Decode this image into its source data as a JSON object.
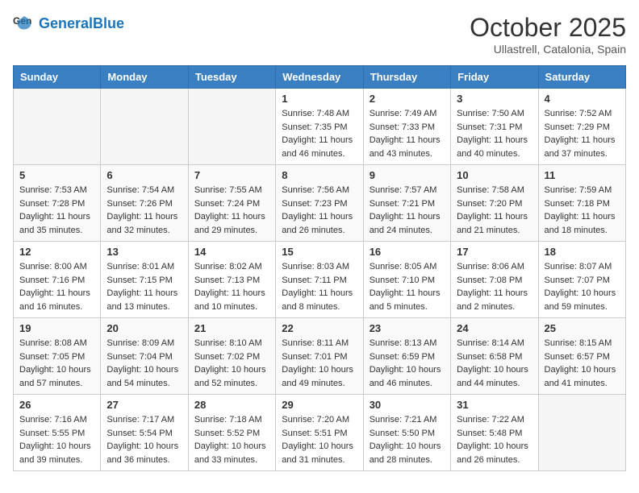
{
  "header": {
    "logo_general": "General",
    "logo_blue": "Blue",
    "month_year": "October 2025",
    "location": "Ullastrell, Catalonia, Spain"
  },
  "days_of_week": [
    "Sunday",
    "Monday",
    "Tuesday",
    "Wednesday",
    "Thursday",
    "Friday",
    "Saturday"
  ],
  "weeks": [
    [
      {
        "day": "",
        "info": ""
      },
      {
        "day": "",
        "info": ""
      },
      {
        "day": "",
        "info": ""
      },
      {
        "day": "1",
        "info": "Sunrise: 7:48 AM\nSunset: 7:35 PM\nDaylight: 11 hours and 46 minutes."
      },
      {
        "day": "2",
        "info": "Sunrise: 7:49 AM\nSunset: 7:33 PM\nDaylight: 11 hours and 43 minutes."
      },
      {
        "day": "3",
        "info": "Sunrise: 7:50 AM\nSunset: 7:31 PM\nDaylight: 11 hours and 40 minutes."
      },
      {
        "day": "4",
        "info": "Sunrise: 7:52 AM\nSunset: 7:29 PM\nDaylight: 11 hours and 37 minutes."
      }
    ],
    [
      {
        "day": "5",
        "info": "Sunrise: 7:53 AM\nSunset: 7:28 PM\nDaylight: 11 hours and 35 minutes."
      },
      {
        "day": "6",
        "info": "Sunrise: 7:54 AM\nSunset: 7:26 PM\nDaylight: 11 hours and 32 minutes."
      },
      {
        "day": "7",
        "info": "Sunrise: 7:55 AM\nSunset: 7:24 PM\nDaylight: 11 hours and 29 minutes."
      },
      {
        "day": "8",
        "info": "Sunrise: 7:56 AM\nSunset: 7:23 PM\nDaylight: 11 hours and 26 minutes."
      },
      {
        "day": "9",
        "info": "Sunrise: 7:57 AM\nSunset: 7:21 PM\nDaylight: 11 hours and 24 minutes."
      },
      {
        "day": "10",
        "info": "Sunrise: 7:58 AM\nSunset: 7:20 PM\nDaylight: 11 hours and 21 minutes."
      },
      {
        "day": "11",
        "info": "Sunrise: 7:59 AM\nSunset: 7:18 PM\nDaylight: 11 hours and 18 minutes."
      }
    ],
    [
      {
        "day": "12",
        "info": "Sunrise: 8:00 AM\nSunset: 7:16 PM\nDaylight: 11 hours and 16 minutes."
      },
      {
        "day": "13",
        "info": "Sunrise: 8:01 AM\nSunset: 7:15 PM\nDaylight: 11 hours and 13 minutes."
      },
      {
        "day": "14",
        "info": "Sunrise: 8:02 AM\nSunset: 7:13 PM\nDaylight: 11 hours and 10 minutes."
      },
      {
        "day": "15",
        "info": "Sunrise: 8:03 AM\nSunset: 7:11 PM\nDaylight: 11 hours and 8 minutes."
      },
      {
        "day": "16",
        "info": "Sunrise: 8:05 AM\nSunset: 7:10 PM\nDaylight: 11 hours and 5 minutes."
      },
      {
        "day": "17",
        "info": "Sunrise: 8:06 AM\nSunset: 7:08 PM\nDaylight: 11 hours and 2 minutes."
      },
      {
        "day": "18",
        "info": "Sunrise: 8:07 AM\nSunset: 7:07 PM\nDaylight: 10 hours and 59 minutes."
      }
    ],
    [
      {
        "day": "19",
        "info": "Sunrise: 8:08 AM\nSunset: 7:05 PM\nDaylight: 10 hours and 57 minutes."
      },
      {
        "day": "20",
        "info": "Sunrise: 8:09 AM\nSunset: 7:04 PM\nDaylight: 10 hours and 54 minutes."
      },
      {
        "day": "21",
        "info": "Sunrise: 8:10 AM\nSunset: 7:02 PM\nDaylight: 10 hours and 52 minutes."
      },
      {
        "day": "22",
        "info": "Sunrise: 8:11 AM\nSunset: 7:01 PM\nDaylight: 10 hours and 49 minutes."
      },
      {
        "day": "23",
        "info": "Sunrise: 8:13 AM\nSunset: 6:59 PM\nDaylight: 10 hours and 46 minutes."
      },
      {
        "day": "24",
        "info": "Sunrise: 8:14 AM\nSunset: 6:58 PM\nDaylight: 10 hours and 44 minutes."
      },
      {
        "day": "25",
        "info": "Sunrise: 8:15 AM\nSunset: 6:57 PM\nDaylight: 10 hours and 41 minutes."
      }
    ],
    [
      {
        "day": "26",
        "info": "Sunrise: 7:16 AM\nSunset: 5:55 PM\nDaylight: 10 hours and 39 minutes."
      },
      {
        "day": "27",
        "info": "Sunrise: 7:17 AM\nSunset: 5:54 PM\nDaylight: 10 hours and 36 minutes."
      },
      {
        "day": "28",
        "info": "Sunrise: 7:18 AM\nSunset: 5:52 PM\nDaylight: 10 hours and 33 minutes."
      },
      {
        "day": "29",
        "info": "Sunrise: 7:20 AM\nSunset: 5:51 PM\nDaylight: 10 hours and 31 minutes."
      },
      {
        "day": "30",
        "info": "Sunrise: 7:21 AM\nSunset: 5:50 PM\nDaylight: 10 hours and 28 minutes."
      },
      {
        "day": "31",
        "info": "Sunrise: 7:22 AM\nSunset: 5:48 PM\nDaylight: 10 hours and 26 minutes."
      },
      {
        "day": "",
        "info": ""
      }
    ]
  ]
}
